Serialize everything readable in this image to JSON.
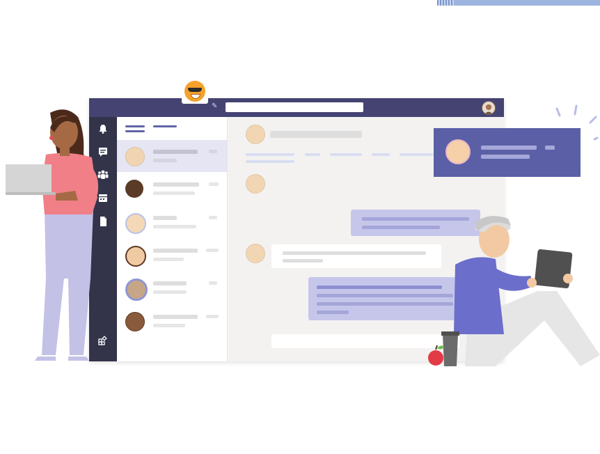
{
  "colors": {
    "brand": "#6264a7",
    "titlebar": "#454372",
    "rail": "#33344a",
    "notification": "#5b5fa6",
    "selected_row": "#e5e5f3",
    "purple_bubble": "#c6c6eb"
  },
  "titlebar": {
    "icons": [
      "compose-icon",
      "search-box",
      "user-avatar"
    ]
  },
  "rail": {
    "icons": [
      "bell-icon",
      "chat-icon",
      "teams-icon",
      "calendar-icon",
      "files-icon",
      "apps-icon"
    ]
  },
  "chat_list": {
    "row_count": 6,
    "selected_index": 0
  },
  "illustration": {
    "left_person": "woman-with-laptop",
    "right_person": "man-with-tablet",
    "props": [
      "apple",
      "cup"
    ]
  }
}
